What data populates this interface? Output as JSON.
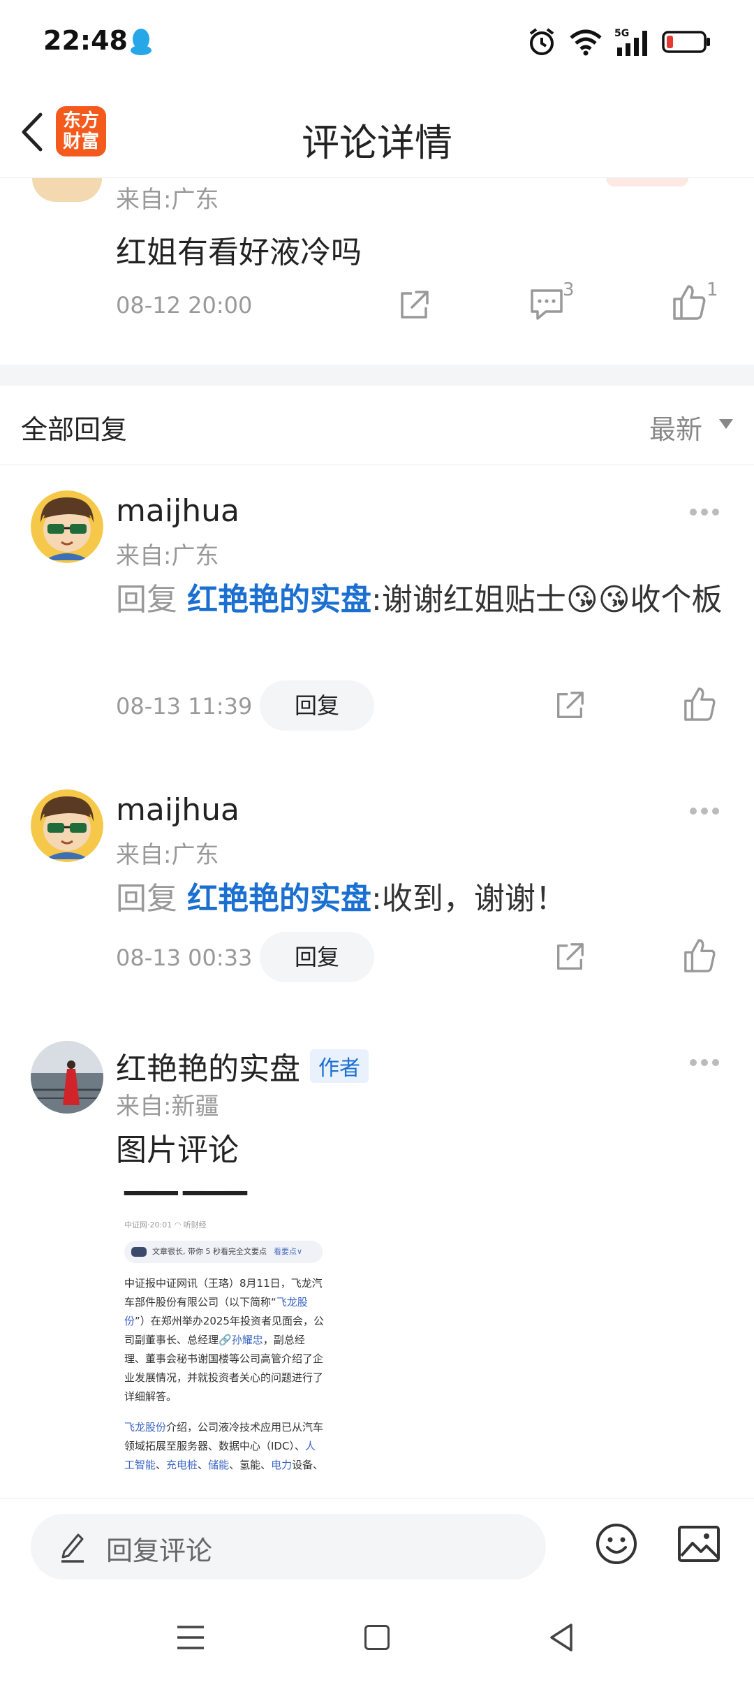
{
  "status_bar": {
    "time": "22:48",
    "icons": [
      "qq-icon",
      "alarm-icon",
      "wifi-icon",
      "signal-icon",
      "battery-icon"
    ],
    "network": "5G"
  },
  "header": {
    "back_icon": "chevron-left-icon",
    "logo_text": "东方财富",
    "title": "评论详情"
  },
  "main_comment": {
    "source": "来自:广东",
    "body": "红姐有看好液冷吗",
    "date": "08-12 20:00",
    "comment_count": "3",
    "like_count": "1"
  },
  "replies_section": {
    "title": "全部回复",
    "sort_label": "最新"
  },
  "replies": [
    {
      "user": "maijhua",
      "source": "来自:广东",
      "prefix": "回复 ",
      "mention": "红艳艳的实盘",
      "text": ":谢谢红姐贴士😘😘收个板",
      "date": "08-13 11:39",
      "reply_label": "回复"
    },
    {
      "user": "maijhua",
      "source": "来自:广东",
      "prefix": "回复 ",
      "mention": "红艳艳的实盘",
      "text": ":收到，谢谢！",
      "date": "08-13 00:33",
      "reply_label": "回复"
    },
    {
      "user": "红艳艳的实盘",
      "badge": "作者",
      "source": "来自:新疆",
      "text": "图片评论"
    }
  ],
  "image_comment": {
    "meta": "中证网·20:01   ◠ 听财经",
    "pill_text": "文章很长, 带你 5 秒看完全文要点",
    "pill_link": "看要点∨",
    "para1_a": "中证报中证网讯（王珞）8月11日，飞龙汽车部件股份有限公司（以下简称“",
    "para1_link": "飞龙股份",
    "para1_b": "”）在郑州举办2025年投资者见面会，公司副董事长、总经理",
    "para1_link2": "🔗孙耀忠",
    "para1_c": "，副总经理、董事会秘书谢国楼等公司高管介绍了企业发展情况，并就投资者关心的问题进行了详细解答。",
    "para2_link": "飞龙股份",
    "para2_a": "介绍，公司液冷技术应用已从汽车领域拓展至服务器、数据中心（IDC）、",
    "para2_link2": "人工智能",
    "para2_b": "、",
    "para2_link3": "充电桩",
    "para2_c": "、",
    "para2_link4": "储能",
    "para2_d": "、氢能、",
    "para2_link5": "电力",
    "para2_e": "设备、"
  },
  "composer": {
    "placeholder": "回复评论",
    "icons": [
      "pencil-icon",
      "emoji-icon",
      "image-icon"
    ]
  },
  "nav_bar": {
    "icons": [
      "menu-icon",
      "home-icon",
      "back-icon"
    ]
  },
  "colors": {
    "accent_blue": "#1a6fd0",
    "brand_orange": "#f35a1c",
    "muted_gray": "#999999",
    "band_gray": "#f4f5f7"
  }
}
